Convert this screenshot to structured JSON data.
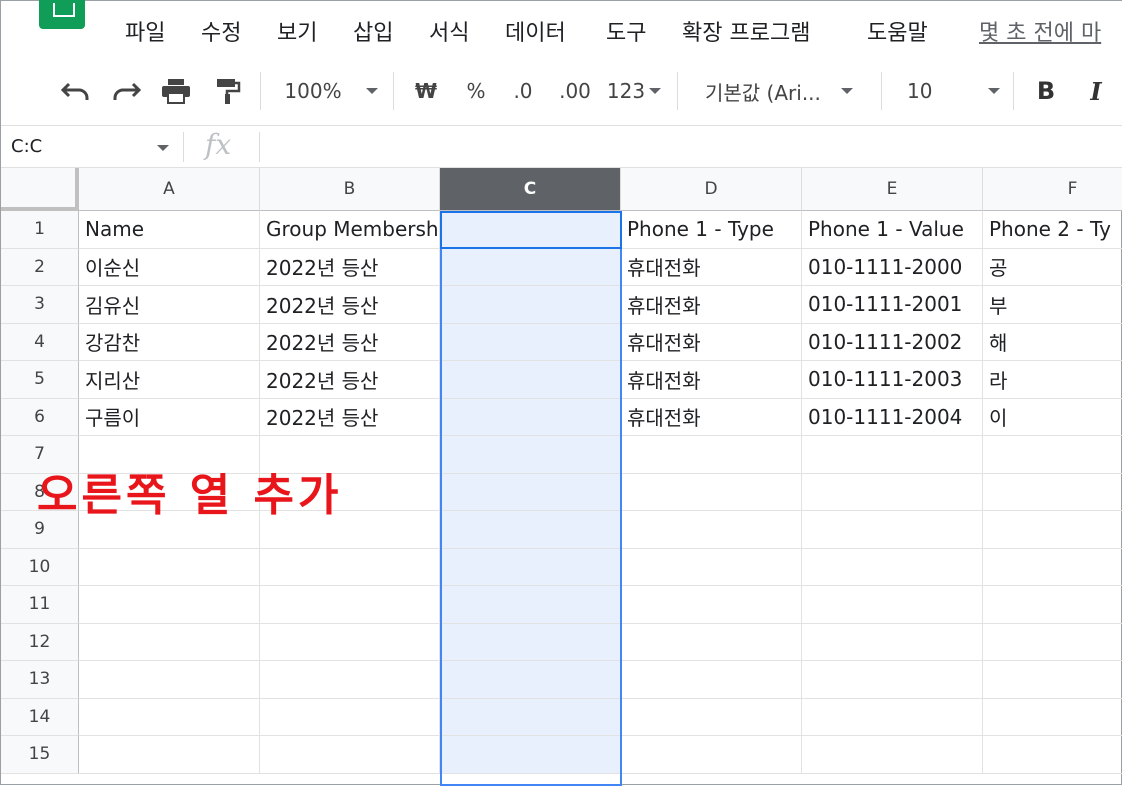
{
  "menu": {
    "items": [
      "파일",
      "수정",
      "보기",
      "삽입",
      "서식",
      "데이터",
      "도구",
      "확장 프로그램",
      "도움말"
    ],
    "last_edit": "몇 초 전에 마"
  },
  "toolbar": {
    "zoom": "100%",
    "currency": "₩",
    "percent": "%",
    "dec_decrease": ".0",
    "dec_increase": ".00",
    "more_formats": "123",
    "font": "기본값 (Ari...",
    "font_size": "10",
    "bold": "B",
    "italic": "I"
  },
  "formula_bar": {
    "name_box": "C:C",
    "fx": "fx",
    "value": ""
  },
  "sheet": {
    "columns": [
      "A",
      "B",
      "C",
      "D",
      "E",
      "F"
    ],
    "selected_column": "C",
    "row_numbers": [
      "1",
      "2",
      "3",
      "4",
      "5",
      "6",
      "7",
      "8",
      "9",
      "10",
      "11",
      "12",
      "13",
      "14",
      "15"
    ],
    "rows": [
      [
        "Name",
        "Group Membership",
        "",
        "Phone 1 - Type",
        "Phone 1 - Value",
        "Phone 2 - Ty"
      ],
      [
        "이순신",
        "2022년 등산",
        "",
        "휴대전화",
        "010-1111-2000",
        "공"
      ],
      [
        "김유신",
        "2022년 등산",
        "",
        "휴대전화",
        "010-1111-2001",
        "부"
      ],
      [
        "강감찬",
        "2022년 등산",
        "",
        "휴대전화",
        "010-1111-2002",
        "해"
      ],
      [
        "지리산",
        "2022년 등산",
        "",
        "휴대전화",
        "010-1111-2003",
        "라"
      ],
      [
        "구름이",
        "2022년 등산",
        "",
        "휴대전화",
        "010-1111-2004",
        "이"
      ]
    ]
  },
  "annotation": "오른쪽 열 추가",
  "colors": {
    "annotation": "#e8151b",
    "selection": "#4285f4",
    "selected_fill": "#e8f0fe",
    "brand": "#0f9d58"
  }
}
